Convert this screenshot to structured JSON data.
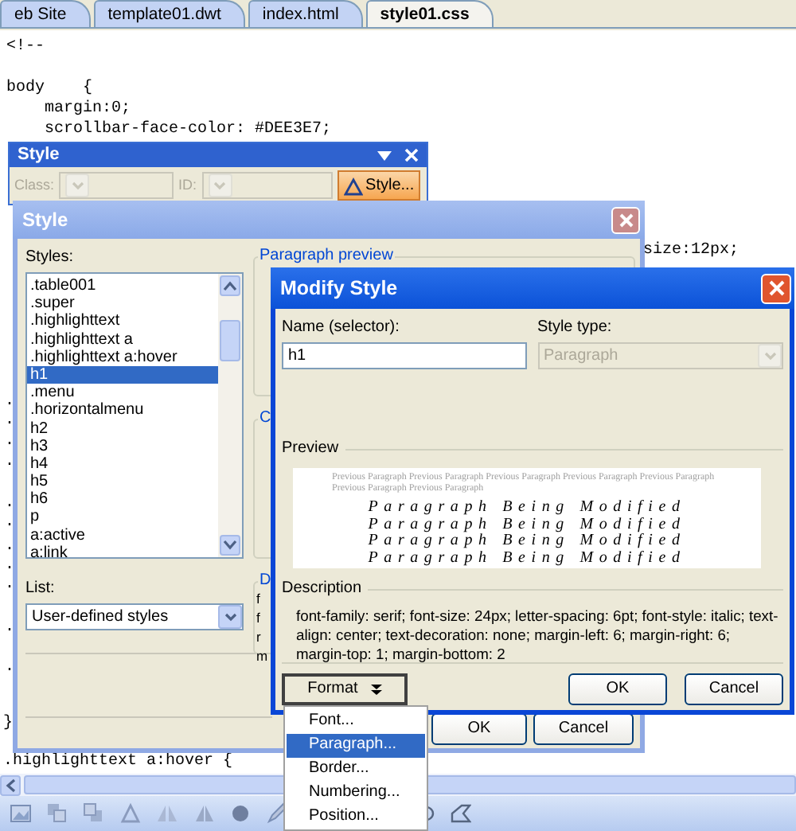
{
  "tabs": [
    {
      "label": "eb Site",
      "selected": false
    },
    {
      "label": "template01.dwt",
      "selected": false
    },
    {
      "label": "index.html",
      "selected": false
    },
    {
      "label": "style01.css",
      "selected": true
    }
  ],
  "editor": {
    "lines": [
      "<!--",
      "body    {",
      "margin:0;",
      "scrollbar-face-color: #DEE3E7;",
      "size:12px;",
      ".",
      ".",
      ".",
      ".",
      ".",
      ".",
      ".",
      ".",
      ".",
      ".",
      ".",
      "}",
      ".highlighttext a:hover {"
    ]
  },
  "style_toolbar": {
    "title": "Style",
    "class_label": "Class:",
    "id_label": "ID:",
    "disabled": true,
    "style_button": "Style..."
  },
  "style_dialog": {
    "title": "Style",
    "styles_label": "Styles:",
    "styles": [
      {
        "label": ".table001",
        "selected": false
      },
      {
        "label": ".super",
        "selected": false
      },
      {
        "label": ".highlighttext",
        "selected": false
      },
      {
        "label": ".highlighttext a",
        "selected": false
      },
      {
        "label": ".highlighttext a:hover",
        "selected": false
      },
      {
        "label": "h1",
        "selected": true
      },
      {
        "label": ".menu",
        "selected": false
      },
      {
        "label": ".horizontalmenu",
        "selected": false
      },
      {
        "label": "h2",
        "selected": false
      },
      {
        "label": "h3",
        "selected": false
      },
      {
        "label": "h4",
        "selected": false
      },
      {
        "label": "h5",
        "selected": false
      },
      {
        "label": "h6",
        "selected": false
      },
      {
        "label": "p",
        "selected": false
      },
      {
        "label": "a:active",
        "selected": false
      },
      {
        "label": "a:link",
        "selected": false
      }
    ],
    "list_label": "List:",
    "list_value": "User-defined styles",
    "paragraph_preview_label": "Paragraph preview",
    "group_2_label": "C",
    "group_3_label": "D",
    "group_3_lines": [
      "f",
      "f",
      "r",
      "m"
    ],
    "ok_button": "OK",
    "cancel_button": "Cancel"
  },
  "modify_style": {
    "title": "Modify Style",
    "name_label": "Name (selector):",
    "name_value": "h1",
    "style_type_label": "Style type:",
    "style_type_value": "Paragraph",
    "style_type_disabled": true,
    "preview_label": "Preview",
    "previous_paragraph": "Previous Paragraph Previous Paragraph Previous Paragraph Previous Paragraph Previous Paragraph Previous Paragraph Previous Paragraph",
    "modified_paragraph": [
      "Paragraph Being Modified",
      "Paragraph Being Modified",
      "Paragraph Being Modified",
      "Paragraph Being Modified"
    ],
    "description_label": "Description",
    "description": "font-family: serif; font-size: 24px; letter-spacing: 6pt; font-style: italic; text-align: center; text-decoration: none; margin-left: 6; margin-right: 6; margin-top: 1; margin-bottom: 2",
    "format_button": "Format",
    "ok_button": "OK",
    "cancel_button": "Cancel"
  },
  "format_menu": [
    {
      "label": "Font...",
      "selected": false
    },
    {
      "label": "Paragraph...",
      "selected": true
    },
    {
      "label": "Border...",
      "selected": false
    },
    {
      "label": "Numbering...",
      "selected": false
    },
    {
      "label": "Position...",
      "selected": false
    }
  ]
}
